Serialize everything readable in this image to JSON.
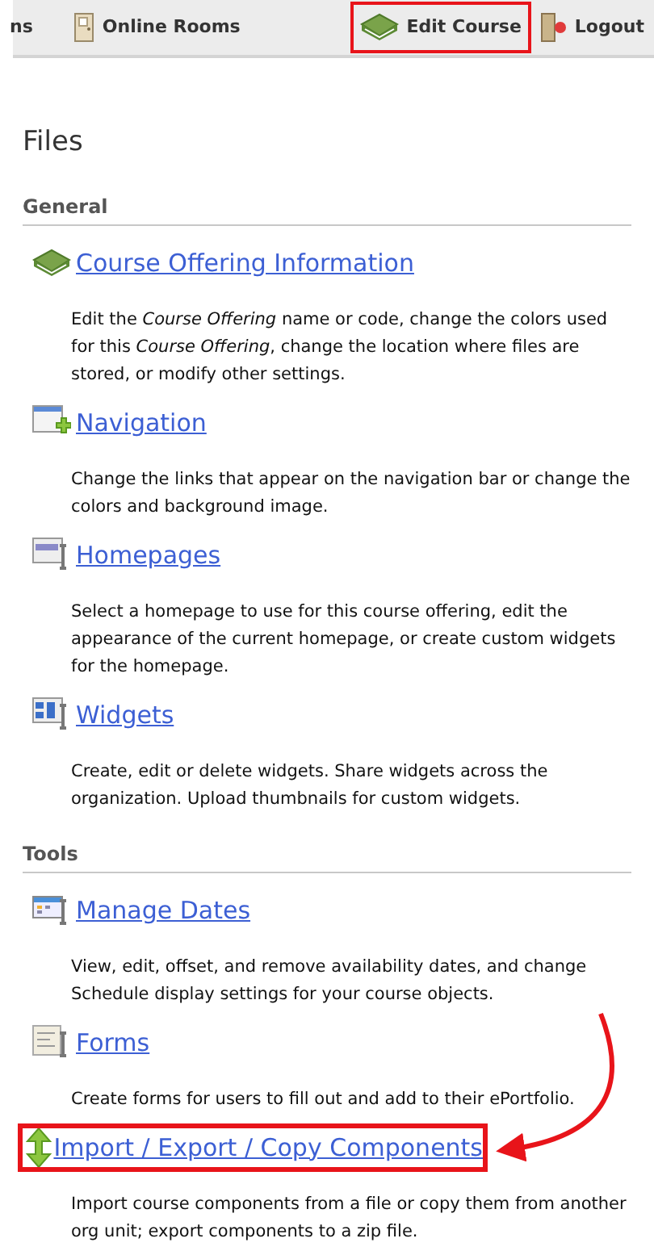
{
  "navbar": {
    "items": [
      {
        "label": "ns",
        "kind": "none",
        "highlighted": false
      },
      {
        "label": "Online Rooms",
        "kind": "door",
        "highlighted": false
      },
      {
        "label": "Edit Course",
        "kind": "book",
        "highlighted": true
      },
      {
        "label": "Logout",
        "kind": "exit",
        "highlighted": false
      }
    ]
  },
  "page_title": "Files",
  "sections": [
    {
      "heading": "General",
      "items": [
        {
          "title": "Course Offering Information",
          "kind": "book",
          "highlighted": false,
          "description": "Edit the *Course Offering* name or code, change the colors used for this *Course Offering*, change the location where files are stored, or modify other settings."
        },
        {
          "title": "Navigation",
          "kind": "navigation",
          "highlighted": false,
          "description": "Change the links that appear on the navigation bar or change the colors and background image."
        },
        {
          "title": "Homepages",
          "kind": "homepages",
          "highlighted": false,
          "description": "Select a homepage to use for this course offering, edit the appearance of the current homepage, or create custom widgets for the homepage."
        },
        {
          "title": "Widgets",
          "kind": "widgets",
          "highlighted": false,
          "description": "Create, edit or delete widgets. Share widgets across the organization. Upload thumbnails for custom widgets."
        }
      ]
    },
    {
      "heading": "Tools",
      "items": [
        {
          "title": "Manage Dates",
          "kind": "dates",
          "highlighted": false,
          "description": "View, edit, offset, and remove availability dates, and change Schedule display settings for your course objects."
        },
        {
          "title": "Forms",
          "kind": "forms",
          "highlighted": false,
          "description": "Create forms for users to fill out and add to their ePortfolio."
        },
        {
          "title": "Import / Export / Copy Components",
          "kind": "import",
          "highlighted": true,
          "description": "Import course components from a file or copy them from another org unit; export components to a zip file."
        }
      ]
    }
  ]
}
